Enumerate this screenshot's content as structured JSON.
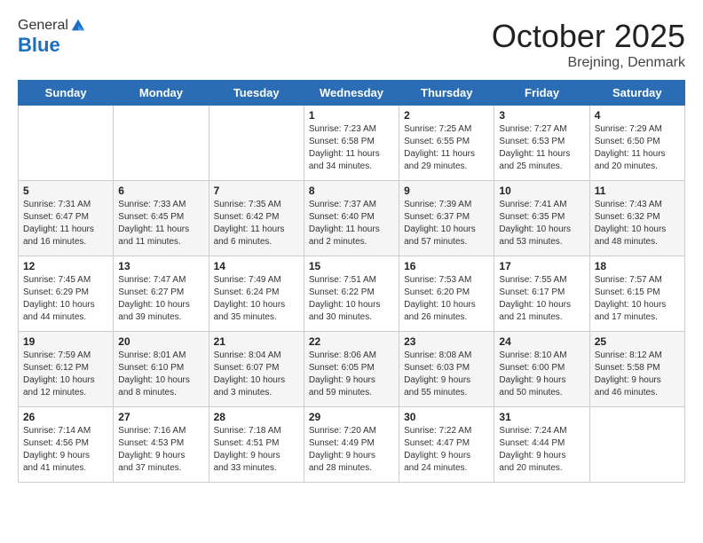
{
  "logo": {
    "general": "General",
    "blue": "Blue"
  },
  "header": {
    "month": "October 2025",
    "location": "Brejning, Denmark"
  },
  "weekdays": [
    "Sunday",
    "Monday",
    "Tuesday",
    "Wednesday",
    "Thursday",
    "Friday",
    "Saturday"
  ],
  "weeks": [
    [
      {
        "day": "",
        "info": ""
      },
      {
        "day": "",
        "info": ""
      },
      {
        "day": "",
        "info": ""
      },
      {
        "day": "1",
        "info": "Sunrise: 7:23 AM\nSunset: 6:58 PM\nDaylight: 11 hours\nand 34 minutes."
      },
      {
        "day": "2",
        "info": "Sunrise: 7:25 AM\nSunset: 6:55 PM\nDaylight: 11 hours\nand 29 minutes."
      },
      {
        "day": "3",
        "info": "Sunrise: 7:27 AM\nSunset: 6:53 PM\nDaylight: 11 hours\nand 25 minutes."
      },
      {
        "day": "4",
        "info": "Sunrise: 7:29 AM\nSunset: 6:50 PM\nDaylight: 11 hours\nand 20 minutes."
      }
    ],
    [
      {
        "day": "5",
        "info": "Sunrise: 7:31 AM\nSunset: 6:47 PM\nDaylight: 11 hours\nand 16 minutes."
      },
      {
        "day": "6",
        "info": "Sunrise: 7:33 AM\nSunset: 6:45 PM\nDaylight: 11 hours\nand 11 minutes."
      },
      {
        "day": "7",
        "info": "Sunrise: 7:35 AM\nSunset: 6:42 PM\nDaylight: 11 hours\nand 6 minutes."
      },
      {
        "day": "8",
        "info": "Sunrise: 7:37 AM\nSunset: 6:40 PM\nDaylight: 11 hours\nand 2 minutes."
      },
      {
        "day": "9",
        "info": "Sunrise: 7:39 AM\nSunset: 6:37 PM\nDaylight: 10 hours\nand 57 minutes."
      },
      {
        "day": "10",
        "info": "Sunrise: 7:41 AM\nSunset: 6:35 PM\nDaylight: 10 hours\nand 53 minutes."
      },
      {
        "day": "11",
        "info": "Sunrise: 7:43 AM\nSunset: 6:32 PM\nDaylight: 10 hours\nand 48 minutes."
      }
    ],
    [
      {
        "day": "12",
        "info": "Sunrise: 7:45 AM\nSunset: 6:29 PM\nDaylight: 10 hours\nand 44 minutes."
      },
      {
        "day": "13",
        "info": "Sunrise: 7:47 AM\nSunset: 6:27 PM\nDaylight: 10 hours\nand 39 minutes."
      },
      {
        "day": "14",
        "info": "Sunrise: 7:49 AM\nSunset: 6:24 PM\nDaylight: 10 hours\nand 35 minutes."
      },
      {
        "day": "15",
        "info": "Sunrise: 7:51 AM\nSunset: 6:22 PM\nDaylight: 10 hours\nand 30 minutes."
      },
      {
        "day": "16",
        "info": "Sunrise: 7:53 AM\nSunset: 6:20 PM\nDaylight: 10 hours\nand 26 minutes."
      },
      {
        "day": "17",
        "info": "Sunrise: 7:55 AM\nSunset: 6:17 PM\nDaylight: 10 hours\nand 21 minutes."
      },
      {
        "day": "18",
        "info": "Sunrise: 7:57 AM\nSunset: 6:15 PM\nDaylight: 10 hours\nand 17 minutes."
      }
    ],
    [
      {
        "day": "19",
        "info": "Sunrise: 7:59 AM\nSunset: 6:12 PM\nDaylight: 10 hours\nand 12 minutes."
      },
      {
        "day": "20",
        "info": "Sunrise: 8:01 AM\nSunset: 6:10 PM\nDaylight: 10 hours\nand 8 minutes."
      },
      {
        "day": "21",
        "info": "Sunrise: 8:04 AM\nSunset: 6:07 PM\nDaylight: 10 hours\nand 3 minutes."
      },
      {
        "day": "22",
        "info": "Sunrise: 8:06 AM\nSunset: 6:05 PM\nDaylight: 9 hours\nand 59 minutes."
      },
      {
        "day": "23",
        "info": "Sunrise: 8:08 AM\nSunset: 6:03 PM\nDaylight: 9 hours\nand 55 minutes."
      },
      {
        "day": "24",
        "info": "Sunrise: 8:10 AM\nSunset: 6:00 PM\nDaylight: 9 hours\nand 50 minutes."
      },
      {
        "day": "25",
        "info": "Sunrise: 8:12 AM\nSunset: 5:58 PM\nDaylight: 9 hours\nand 46 minutes."
      }
    ],
    [
      {
        "day": "26",
        "info": "Sunrise: 7:14 AM\nSunset: 4:56 PM\nDaylight: 9 hours\nand 41 minutes."
      },
      {
        "day": "27",
        "info": "Sunrise: 7:16 AM\nSunset: 4:53 PM\nDaylight: 9 hours\nand 37 minutes."
      },
      {
        "day": "28",
        "info": "Sunrise: 7:18 AM\nSunset: 4:51 PM\nDaylight: 9 hours\nand 33 minutes."
      },
      {
        "day": "29",
        "info": "Sunrise: 7:20 AM\nSunset: 4:49 PM\nDaylight: 9 hours\nand 28 minutes."
      },
      {
        "day": "30",
        "info": "Sunrise: 7:22 AM\nSunset: 4:47 PM\nDaylight: 9 hours\nand 24 minutes."
      },
      {
        "day": "31",
        "info": "Sunrise: 7:24 AM\nSunset: 4:44 PM\nDaylight: 9 hours\nand 20 minutes."
      },
      {
        "day": "",
        "info": ""
      }
    ]
  ]
}
